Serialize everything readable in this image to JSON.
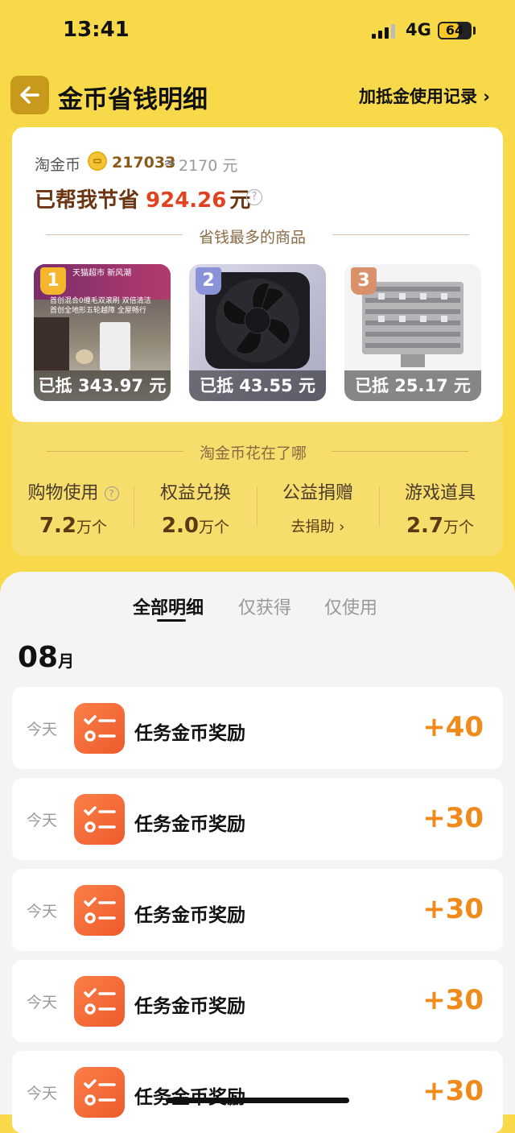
{
  "status_bar": {
    "time": "13:41",
    "network": "4G",
    "battery": "64",
    "battery_level": 0.64
  },
  "header": {
    "title": "金币省钱明细",
    "record_link": "加抵金使用记录 ›"
  },
  "savings": {
    "coin_label": "淘金币",
    "coin_count": "217033",
    "approx": "≈",
    "coin_value": "2170 元",
    "saved_prefix": "已帮我节省",
    "saved_amount": "924.26",
    "saved_unit": "元",
    "top_products_title": "省钱最多的商品",
    "products": [
      {
        "rank": "1",
        "discount": "已抵 343.97 元",
        "rank_color": "#f3b62d",
        "banner_top": "天猫超市 新风潮",
        "banner_l1": "首创混合0缠毛双滚刷 双倍清洁",
        "banner_l2": "首创全地形五轮越障 全屋畅行"
      },
      {
        "rank": "2",
        "discount": "已抵 43.55 元",
        "rank_color": "#8b93d8"
      },
      {
        "rank": "3",
        "discount": "已抵 25.17 元",
        "rank_color": "#d8916a"
      }
    ]
  },
  "spent": {
    "title": "淘金币花在了哪",
    "categories": [
      {
        "label": "购物使用",
        "value": "7.2",
        "unit": "万个"
      },
      {
        "label": "权益兑换",
        "value": "2.0",
        "unit": "万个"
      },
      {
        "label": "公益捐赠",
        "action": "去捐助 ›"
      },
      {
        "label": "游戏道具",
        "value": "2.7",
        "unit": "万个"
      }
    ]
  },
  "tabs": [
    "全部明细",
    "仅获得",
    "仅使用"
  ],
  "month": {
    "number": "08",
    "unit": "月"
  },
  "records": [
    {
      "date": "今天",
      "title": "任务金币奖励",
      "points": "+40"
    },
    {
      "date": "今天",
      "title": "任务金币奖励",
      "points": "+30"
    },
    {
      "date": "今天",
      "title": "任务金币奖励",
      "points": "+30"
    },
    {
      "date": "今天",
      "title": "任务金币奖励",
      "points": "+30"
    },
    {
      "date": "今天",
      "title": "任务金币奖励",
      "points": "+30"
    }
  ]
}
